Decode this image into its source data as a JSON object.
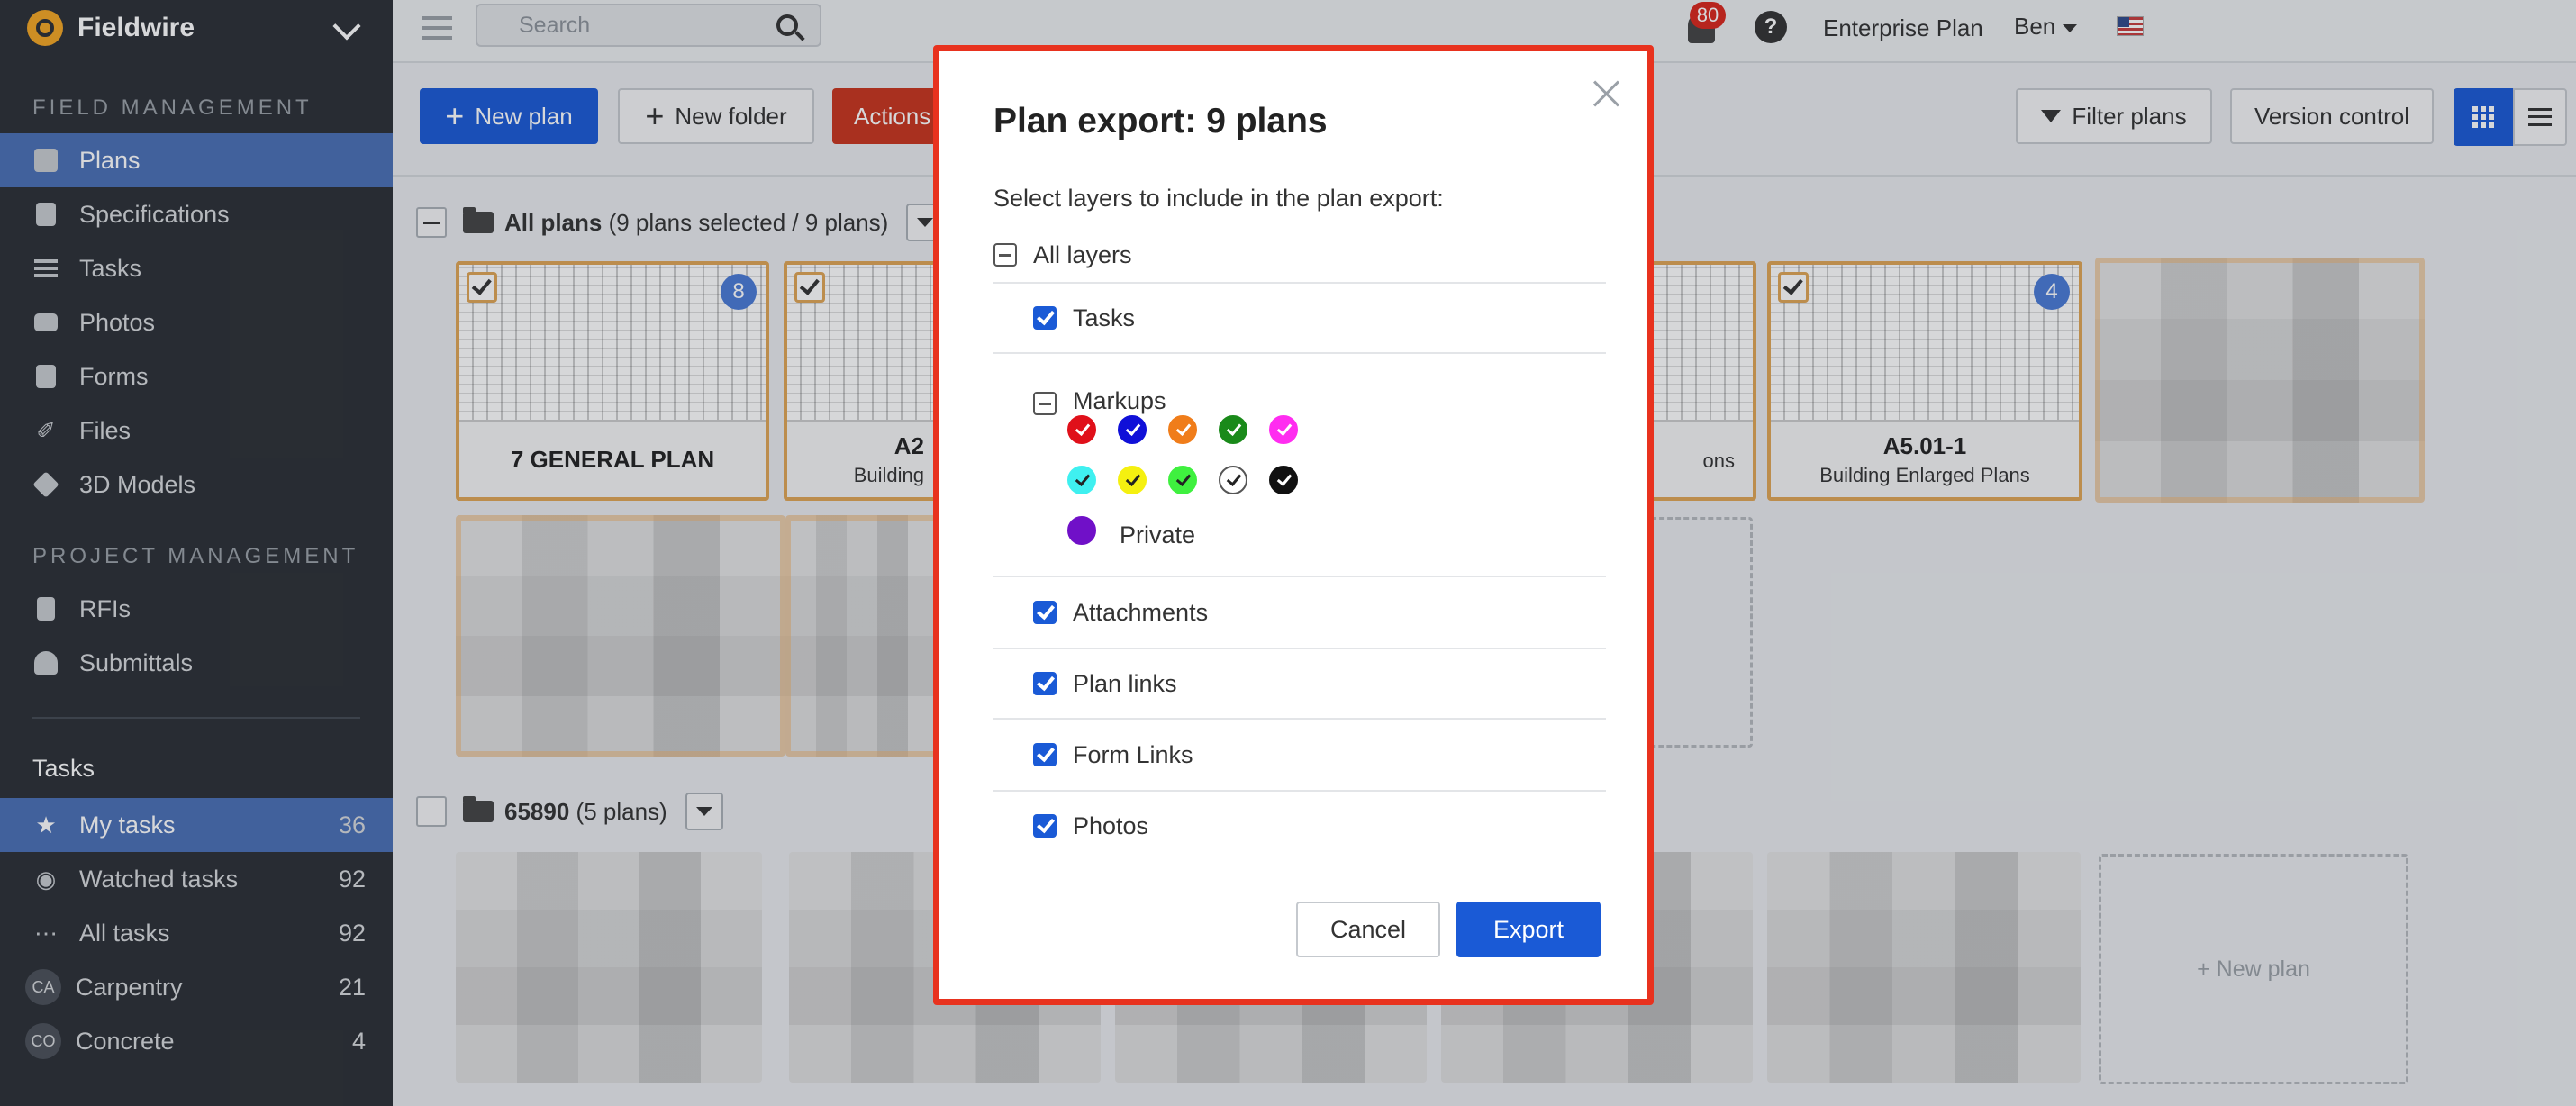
{
  "sidebar": {
    "brand": "Fieldwire",
    "field_management_heading": "FIELD MANAGEMENT",
    "field_items": [
      {
        "label": "Plans",
        "icon": "plans-icon"
      },
      {
        "label": "Specifications",
        "icon": "book-icon"
      },
      {
        "label": "Tasks",
        "icon": "list-icon"
      },
      {
        "label": "Photos",
        "icon": "camera-icon"
      },
      {
        "label": "Forms",
        "icon": "clipboard-icon"
      },
      {
        "label": "Files",
        "icon": "paperclip-icon"
      },
      {
        "label": "3D Models",
        "icon": "cube-icon"
      }
    ],
    "project_management_heading": "PROJECT MANAGEMENT",
    "project_items": [
      {
        "label": "RFIs",
        "icon": "rfi-icon"
      },
      {
        "label": "Submittals",
        "icon": "submittal-icon"
      }
    ],
    "tasks_heading": "Tasks",
    "task_items": [
      {
        "label": "My tasks",
        "count": "36",
        "icon": "star-icon"
      },
      {
        "label": "Watched tasks",
        "count": "92",
        "icon": "eye-icon"
      },
      {
        "label": "All tasks",
        "count": "92",
        "icon": "grid-icon"
      },
      {
        "label": "Carpentry",
        "count": "21",
        "avatar": "CA"
      },
      {
        "label": "Concrete",
        "count": "4",
        "avatar": "CO"
      }
    ]
  },
  "header": {
    "search_placeholder": "Search",
    "notifications_count": "80",
    "help": "?",
    "plan": "Enterprise Plan",
    "user": "Ben"
  },
  "toolbar": {
    "new_plan": "New plan",
    "new_folder": "New folder",
    "actions": "Actions",
    "filter_plans": "Filter plans",
    "version_control": "Version control"
  },
  "content": {
    "folder1_name": "All plans",
    "folder1_meta": "(9 plans selected / 9 plans)",
    "folder2_name": "65890",
    "folder2_meta": "(5 plans)",
    "cards": [
      {
        "title": "7 GENERAL PLAN",
        "sub": "",
        "badge": "8"
      },
      {
        "title": "A2",
        "sub": "Building",
        "badge": ""
      },
      {
        "title": "",
        "sub": "ons",
        "badge": ""
      },
      {
        "title": "A5.01-1",
        "sub": "Building Enlarged Plans",
        "badge": "4"
      }
    ],
    "new_plan_tile": "+ New plan"
  },
  "modal": {
    "title": "Plan export: 9 plans",
    "hint": "Select layers to include in the plan export:",
    "all_layers": "All layers",
    "tasks": "Tasks",
    "markups": "Markups",
    "private": "Private",
    "attachments": "Attachments",
    "plan_links": "Plan links",
    "form_links": "Form Links",
    "photos": "Photos",
    "cancel": "Cancel",
    "export": "Export",
    "markup_colors_row1": [
      "#e0101a",
      "#1010d8",
      "#f07d1a",
      "#1a8a1a",
      "#ff2df0"
    ],
    "markup_colors_row2": [
      "#3ff0f0",
      "#f5f010",
      "#3ff03f",
      "#ffffff",
      "#111111"
    ],
    "private_color": "#7010c8"
  },
  "colors": {
    "accent": "#1a5ad6",
    "sidebar_bg": "#2b2f35",
    "sidebar_active": "#4a6fb5",
    "modal_border": "#e8321e",
    "danger": "#c9341d"
  }
}
